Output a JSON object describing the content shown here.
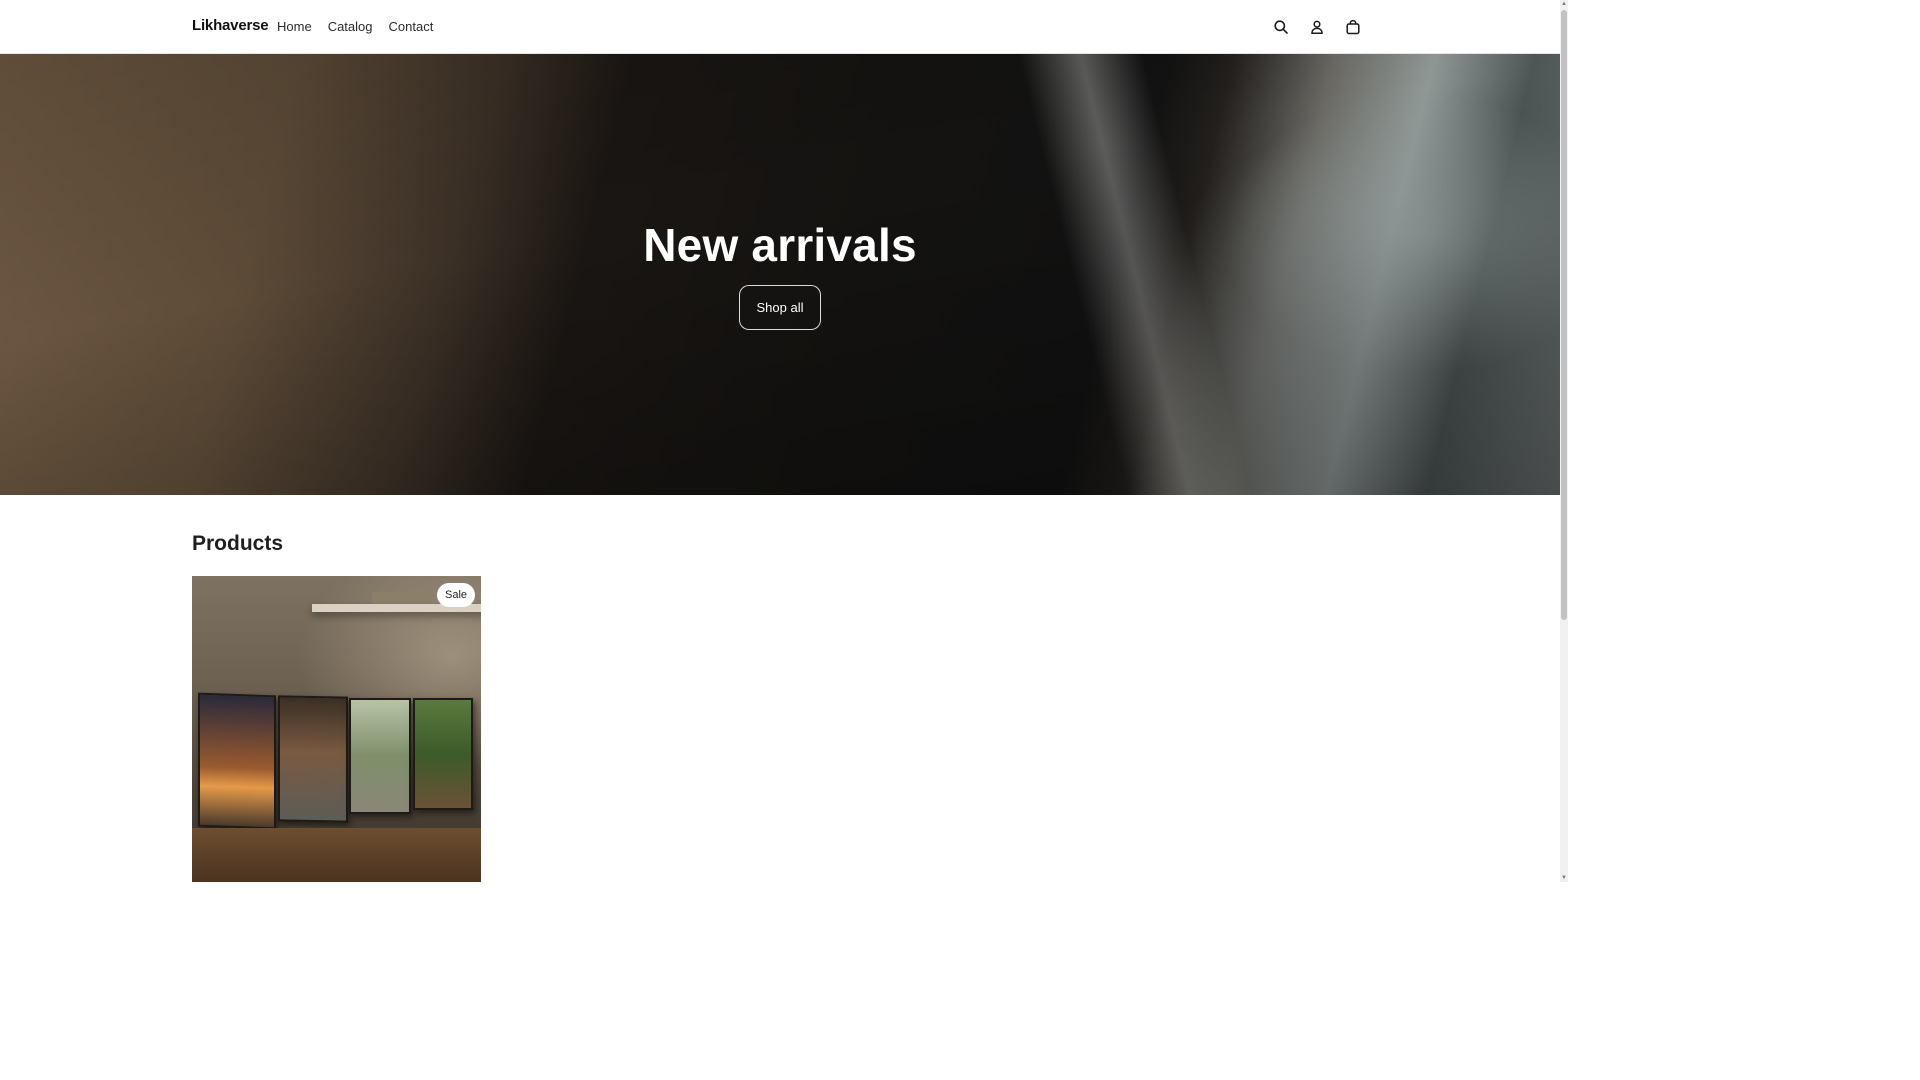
{
  "header": {
    "brand": "Likhaverse",
    "nav": [
      {
        "label": "Home"
      },
      {
        "label": "Catalog"
      },
      {
        "label": "Contact"
      }
    ],
    "icons": [
      "search-icon",
      "account-icon",
      "cart-icon"
    ]
  },
  "hero": {
    "title": "New arrivals",
    "cta_label": "Shop all"
  },
  "products": {
    "title": "Products",
    "items": [
      {
        "badge": "Sale"
      }
    ]
  },
  "scrollbar": {
    "up_glyph": "▲",
    "down_glyph": "▼"
  }
}
